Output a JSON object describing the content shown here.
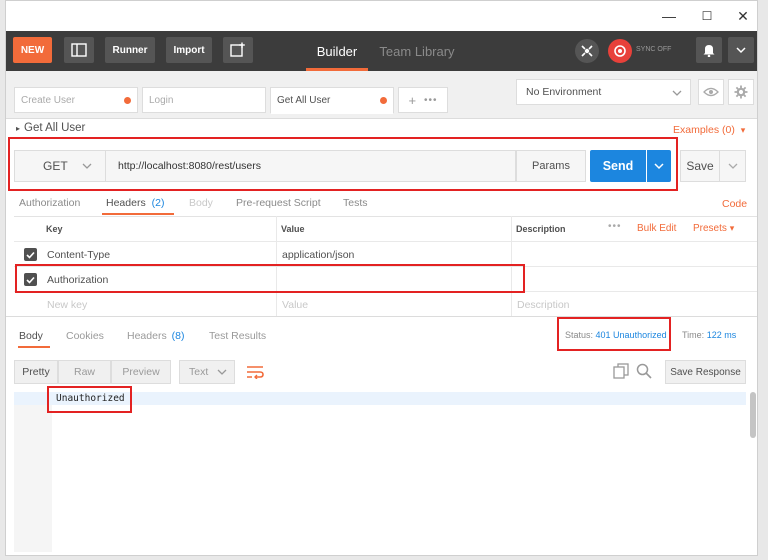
{
  "window_controls": {
    "minimize": "—",
    "maximize": "☐",
    "close": "✕"
  },
  "header": {
    "new_label": "NEW",
    "runner_label": "Runner",
    "import_label": "Import",
    "tabs": [
      {
        "label": "Builder",
        "active": true
      },
      {
        "label": "Team Library",
        "active": false
      }
    ],
    "sync_label": "SYNC OFF"
  },
  "request_tabs": [
    {
      "label": "Create User"
    },
    {
      "label": "Login"
    },
    {
      "label": "Get All User"
    }
  ],
  "environment": {
    "selected": "No Environment"
  },
  "request": {
    "name": "Get All User",
    "examples_label": "Examples (0)",
    "method": "GET",
    "url": "http://localhost:8080/rest/users",
    "params_label": "Params",
    "send_label": "Send",
    "save_label": "Save"
  },
  "request_subtabs": [
    {
      "label": "Authorization"
    },
    {
      "label": "Headers",
      "count": "(2)"
    },
    {
      "label": "Body"
    },
    {
      "label": "Pre-request Script"
    },
    {
      "label": "Tests"
    }
  ],
  "code_label": "Code",
  "headers_table": {
    "columns": [
      "Key",
      "Value",
      "Description"
    ],
    "bulk_edit_label": "Bulk Edit",
    "presets_label": "Presets",
    "rows": [
      {
        "key": "Content-Type",
        "value": "application/json",
        "description": ""
      },
      {
        "key": "Authorization",
        "value": "",
        "description": ""
      }
    ],
    "placeholder": {
      "key": "New key",
      "value": "Value",
      "description": "Description"
    }
  },
  "response_tabs": [
    {
      "label": "Body"
    },
    {
      "label": "Cookies"
    },
    {
      "label": "Headers",
      "count": "(8)"
    },
    {
      "label": "Test Results"
    }
  ],
  "response_status": {
    "status_label": "Status:",
    "status_value": "401 Unauthorized",
    "time_label": "Time:",
    "time_value": "122 ms"
  },
  "view_modes": [
    "Pretty",
    "Raw",
    "Preview"
  ],
  "format_selected": "Text",
  "save_response_label": "Save Response",
  "response_body": "Unauthorized",
  "colors": {
    "accent": "#f26b3a",
    "primary": "#1c86df",
    "header_bg": "#3c3c3c",
    "highlight": "#e32222"
  }
}
